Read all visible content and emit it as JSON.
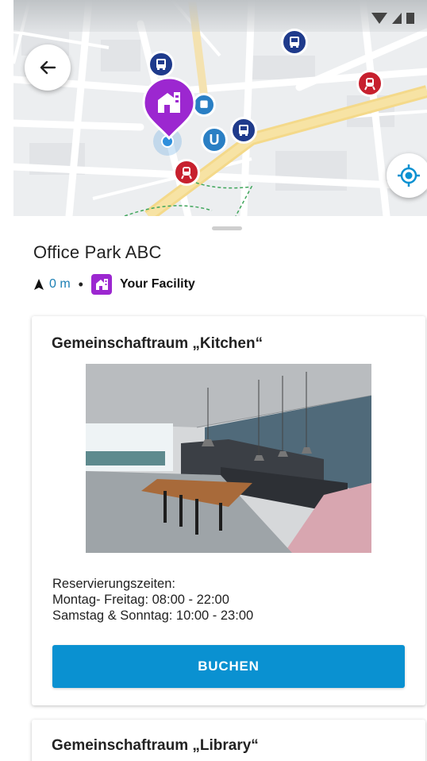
{
  "map": {
    "back_icon": "arrow-left-icon",
    "locate_icon": "my-location-icon",
    "pins": [
      {
        "type": "bus",
        "icon": "bus-icon"
      },
      {
        "type": "bus",
        "icon": "bus-icon"
      },
      {
        "type": "bus",
        "icon": "bus-icon"
      },
      {
        "type": "ubahn",
        "label": "U"
      },
      {
        "type": "train",
        "icon": "train-icon"
      },
      {
        "type": "train",
        "icon": "train-icon"
      }
    ],
    "selected_pin_icon": "building-icon",
    "colors": {
      "selected_pin": "#9c27d0",
      "bus": "#1f3b8c",
      "train": "#c7202e",
      "ubahn": "#2a7fc4"
    }
  },
  "place": {
    "title": "Office Park ABC",
    "distance": "0 m",
    "separator": "•",
    "facility_label": "Your Facility",
    "facility_icon": "building-icon"
  },
  "rooms": [
    {
      "title": "Gemeinschaftraum „Kitchen“",
      "hours_heading": "Reservierungszeiten:",
      "hours_weekday": "Montag- Freitag: 08:00 - 22:00",
      "hours_weekend": "Samstag & Sonntag: 10:00 - 23:00",
      "button_label": "BUCHEN"
    },
    {
      "title": "Gemeinschaftraum „Library“"
    }
  ],
  "colors": {
    "accent": "#0a91d1",
    "facility": "#9c27d0",
    "distance": "#1b7fb4"
  }
}
